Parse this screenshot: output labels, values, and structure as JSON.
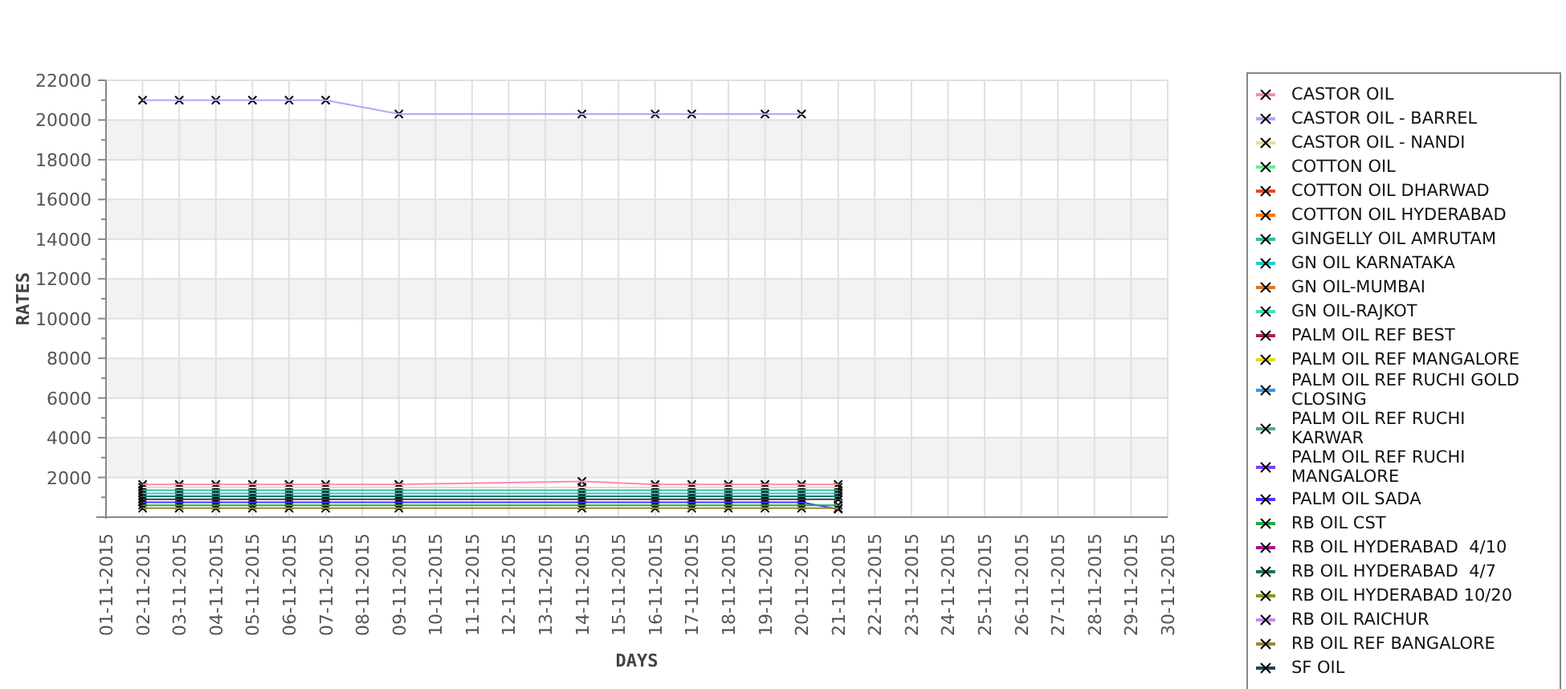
{
  "chart": {
    "chart_data": {
      "type": "line",
      "xlabel": "DAYS",
      "ylabel": "RATES",
      "grid": true,
      "categories": [
        "01-11-2015",
        "02-11-2015",
        "03-11-2015",
        "04-11-2015",
        "05-11-2015",
        "06-11-2015",
        "07-11-2015",
        "08-11-2015",
        "09-11-2015",
        "10-11-2015",
        "11-11-2015",
        "12-11-2015",
        "13-11-2015",
        "14-11-2015",
        "15-11-2015",
        "16-11-2015",
        "17-11-2015",
        "18-11-2015",
        "19-11-2015",
        "20-11-2015",
        "21-11-2015",
        "22-11-2015",
        "23-11-2015",
        "24-11-2015",
        "25-11-2015",
        "26-11-2015",
        "27-11-2015",
        "28-11-2015",
        "29-11-2015",
        "30-11-2015"
      ],
      "ylim": [
        0,
        22000
      ],
      "yticks": [
        2000,
        4000,
        6000,
        8000,
        10000,
        12000,
        14000,
        16000,
        18000,
        20000,
        22000
      ],
      "series": [
        {
          "name": "CASTOR OIL",
          "color": "#ff88bb",
          "marker": "x",
          "values": [
            null,
            1650,
            1650,
            1650,
            1650,
            1650,
            1650,
            null,
            1650,
            null,
            null,
            null,
            null,
            1800,
            null,
            1650,
            1650,
            1650,
            1650,
            1650,
            1650,
            null,
            null,
            null,
            null,
            null,
            null,
            null,
            null,
            null
          ]
        },
        {
          "name": "CASTOR OIL - BARREL",
          "color": "#aaaaff",
          "marker": "x",
          "values": [
            null,
            21000,
            21000,
            21000,
            21000,
            21000,
            21000,
            null,
            20300,
            null,
            null,
            null,
            null,
            20300,
            null,
            20300,
            20300,
            null,
            20300,
            20300,
            null,
            null,
            null,
            null,
            null,
            null,
            null,
            null,
            null,
            null
          ]
        },
        {
          "name": "CASTOR OIL - NANDI",
          "color": "#eedd99",
          "marker": "x",
          "values": [
            null,
            1500,
            1500,
            1500,
            1500,
            1500,
            1500,
            null,
            1500,
            null,
            null,
            null,
            null,
            1500,
            null,
            1500,
            1500,
            1500,
            1500,
            1500,
            1500,
            null,
            null,
            null,
            null,
            null,
            null,
            null,
            null,
            null
          ]
        },
        {
          "name": "COTTON OIL",
          "color": "#66ee99",
          "marker": "x",
          "values": [
            null,
            null,
            null,
            null,
            null,
            null,
            null,
            null,
            null,
            null,
            null,
            null,
            null,
            null,
            null,
            null,
            null,
            null,
            null,
            null,
            null,
            null,
            null,
            null,
            null,
            null,
            null,
            null,
            null,
            null
          ]
        },
        {
          "name": "COTTON OIL DHARWAD",
          "color": "#ee4422",
          "marker": "x",
          "values": [
            null,
            null,
            null,
            null,
            null,
            null,
            null,
            null,
            null,
            null,
            null,
            null,
            null,
            null,
            null,
            null,
            null,
            null,
            null,
            null,
            null,
            null,
            null,
            null,
            null,
            null,
            null,
            null,
            null,
            null
          ]
        },
        {
          "name": "COTTON OIL HYDERABAD",
          "color": "#ff7700",
          "marker": "x",
          "values": [
            null,
            null,
            null,
            null,
            null,
            null,
            null,
            null,
            null,
            null,
            null,
            null,
            null,
            null,
            null,
            null,
            null,
            null,
            null,
            null,
            null,
            null,
            null,
            null,
            null,
            null,
            null,
            null,
            null,
            null
          ]
        },
        {
          "name": "GINGELLY OIL AMRUTAM",
          "color": "#33bbaa",
          "marker": "x",
          "values": [
            null,
            1350,
            1350,
            1350,
            1350,
            1350,
            1350,
            null,
            1350,
            null,
            null,
            null,
            null,
            1350,
            null,
            1350,
            1350,
            1350,
            1350,
            1350,
            1350,
            null,
            null,
            null,
            null,
            null,
            null,
            null,
            null,
            null
          ]
        },
        {
          "name": "GN OIL KARNATAKA",
          "color": "#22cccc",
          "marker": "x",
          "values": [
            null,
            1200,
            1200,
            1200,
            1200,
            1200,
            1200,
            null,
            1200,
            null,
            null,
            null,
            null,
            1200,
            null,
            1200,
            1200,
            1200,
            1200,
            1200,
            1200,
            null,
            null,
            null,
            null,
            null,
            null,
            null,
            null,
            null
          ]
        },
        {
          "name": "GN OIL-MUMBAI",
          "color": "#dd7722",
          "marker": "x",
          "values": [
            null,
            null,
            null,
            null,
            null,
            null,
            null,
            null,
            null,
            null,
            null,
            null,
            null,
            null,
            null,
            null,
            null,
            null,
            null,
            null,
            null,
            null,
            null,
            null,
            null,
            null,
            null,
            null,
            null,
            null
          ]
        },
        {
          "name": "GN OIL-RAJKOT",
          "color": "#44ddbb",
          "marker": "x",
          "values": [
            null,
            null,
            null,
            null,
            null,
            null,
            null,
            null,
            null,
            null,
            null,
            null,
            null,
            null,
            null,
            null,
            null,
            null,
            null,
            null,
            null,
            null,
            null,
            null,
            null,
            null,
            null,
            null,
            null,
            null
          ]
        },
        {
          "name": "PALM OIL REF BEST",
          "color": "#aa2244",
          "marker": "x",
          "values": [
            null,
            null,
            null,
            null,
            null,
            null,
            null,
            null,
            null,
            null,
            null,
            null,
            null,
            null,
            null,
            null,
            null,
            null,
            null,
            null,
            null,
            null,
            null,
            null,
            null,
            null,
            null,
            null,
            null,
            null
          ]
        },
        {
          "name": "PALM OIL REF MANGALORE",
          "color": "#dddd22",
          "marker": "x",
          "values": [
            null,
            null,
            null,
            null,
            null,
            null,
            null,
            null,
            null,
            null,
            null,
            null,
            null,
            null,
            null,
            null,
            null,
            null,
            null,
            null,
            null,
            null,
            null,
            null,
            null,
            null,
            null,
            null,
            null,
            null
          ]
        },
        {
          "name": "PALM OIL REF RUCHI GOLD CLOSING",
          "color": "#3399ee",
          "marker": "x",
          "values": [
            null,
            null,
            null,
            null,
            null,
            null,
            null,
            null,
            null,
            null,
            null,
            null,
            null,
            null,
            null,
            null,
            null,
            null,
            null,
            null,
            null,
            null,
            null,
            null,
            null,
            null,
            null,
            null,
            null,
            null
          ]
        },
        {
          "name": "PALM OIL REF RUCHI KARWAR",
          "color": "#55aa88",
          "marker": "x",
          "values": [
            null,
            null,
            null,
            null,
            null,
            null,
            null,
            null,
            null,
            null,
            null,
            null,
            null,
            null,
            null,
            null,
            null,
            null,
            null,
            null,
            null,
            null,
            null,
            null,
            null,
            null,
            null,
            null,
            null,
            null
          ]
        },
        {
          "name": "PALM OIL REF RUCHI MANGALORE",
          "color": "#7744ee",
          "marker": "x",
          "values": [
            null,
            null,
            null,
            null,
            null,
            null,
            null,
            null,
            null,
            null,
            null,
            null,
            null,
            null,
            null,
            null,
            null,
            null,
            null,
            null,
            null,
            null,
            null,
            null,
            null,
            null,
            null,
            null,
            null,
            null
          ]
        },
        {
          "name": "PALM OIL SADA",
          "color": "#5533ff",
          "marker": "x",
          "values": [
            null,
            750,
            750,
            750,
            750,
            750,
            750,
            null,
            750,
            null,
            null,
            null,
            null,
            750,
            null,
            750,
            750,
            750,
            750,
            750,
            400,
            null,
            null,
            null,
            null,
            null,
            null,
            null,
            null,
            null
          ]
        },
        {
          "name": "RB OIL CST",
          "color": "#22aa44",
          "marker": "x",
          "values": [
            null,
            600,
            600,
            600,
            600,
            600,
            600,
            null,
            600,
            null,
            null,
            null,
            null,
            600,
            null,
            600,
            600,
            600,
            600,
            600,
            600,
            null,
            null,
            null,
            null,
            null,
            null,
            null,
            null,
            null
          ]
        },
        {
          "name": "RB OIL HYDERABAD  4/10",
          "color": "#aa1188",
          "marker": "x",
          "values": [
            null,
            null,
            null,
            null,
            null,
            null,
            null,
            null,
            null,
            null,
            null,
            null,
            null,
            null,
            null,
            null,
            null,
            null,
            null,
            null,
            null,
            null,
            null,
            null,
            null,
            null,
            null,
            null,
            null,
            null
          ]
        },
        {
          "name": "RB OIL HYDERABAD  4/7",
          "color": "#117766",
          "marker": "x",
          "values": [
            null,
            1050,
            1050,
            1050,
            1050,
            1050,
            1050,
            null,
            1050,
            null,
            null,
            null,
            null,
            1050,
            null,
            1050,
            1050,
            1050,
            1050,
            1050,
            1050,
            null,
            null,
            null,
            null,
            null,
            null,
            null,
            null,
            null
          ]
        },
        {
          "name": "RB OIL HYDERABAD 10/20",
          "color": "#889922",
          "marker": "x",
          "values": [
            null,
            null,
            null,
            null,
            null,
            null,
            null,
            null,
            null,
            null,
            null,
            null,
            null,
            null,
            null,
            null,
            null,
            null,
            null,
            null,
            null,
            null,
            null,
            null,
            null,
            null,
            null,
            null,
            null,
            null
          ]
        },
        {
          "name": "RB OIL RAICHUR",
          "color": "#cc88ff",
          "marker": "x",
          "values": [
            null,
            null,
            null,
            null,
            null,
            null,
            null,
            null,
            null,
            null,
            null,
            null,
            null,
            null,
            null,
            null,
            null,
            null,
            null,
            null,
            null,
            null,
            null,
            null,
            null,
            null,
            null,
            null,
            null,
            null
          ]
        },
        {
          "name": "RB OIL REF BANGALORE",
          "color": "#998833",
          "marker": "x",
          "values": [
            null,
            450,
            450,
            450,
            450,
            450,
            450,
            null,
            450,
            null,
            null,
            null,
            null,
            450,
            null,
            450,
            450,
            450,
            450,
            450,
            450,
            null,
            null,
            null,
            null,
            null,
            null,
            null,
            null,
            null
          ]
        },
        {
          "name": "SF OIL",
          "color": "#224455",
          "marker": "x",
          "values": [
            null,
            900,
            900,
            900,
            900,
            900,
            900,
            null,
            900,
            null,
            null,
            null,
            null,
            900,
            null,
            900,
            900,
            900,
            900,
            900,
            900,
            null,
            null,
            null,
            null,
            null,
            null,
            null,
            null,
            null
          ]
        }
      ]
    }
  }
}
